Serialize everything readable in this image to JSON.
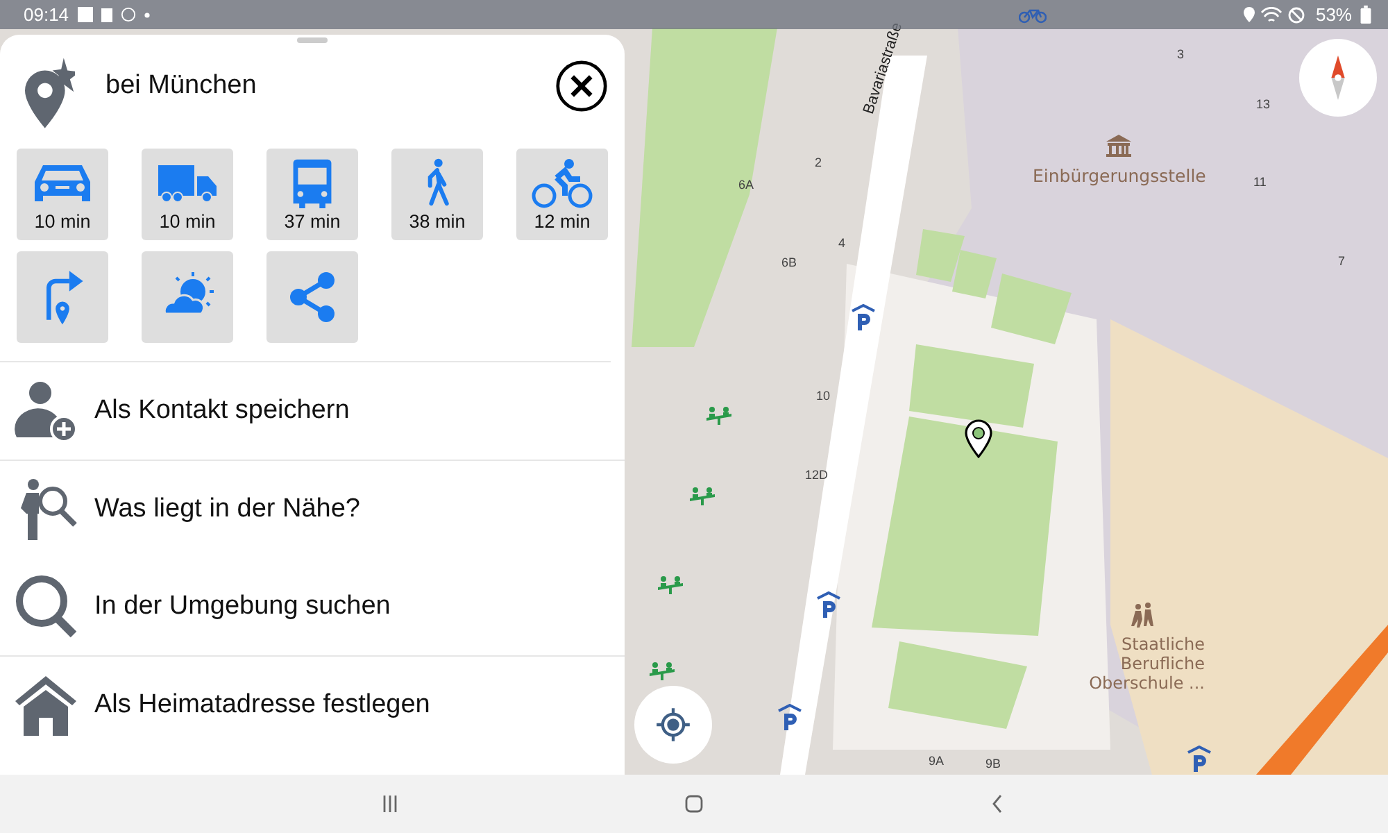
{
  "status_bar": {
    "time": "09:14",
    "battery": "53%"
  },
  "place": {
    "title": "bei München"
  },
  "quick_actions": [
    {
      "kind": "car",
      "label": "10 min"
    },
    {
      "kind": "truck",
      "label": "10 min"
    },
    {
      "kind": "bus",
      "label": "37 min"
    },
    {
      "kind": "walk",
      "label": "38 min"
    },
    {
      "kind": "bike",
      "label": "12 min"
    },
    {
      "kind": "directions"
    },
    {
      "kind": "weather"
    },
    {
      "kind": "share"
    }
  ],
  "menu_sections": [
    [
      {
        "kind": "contact",
        "label": "Als Kontakt speichern"
      }
    ],
    [
      {
        "kind": "nearby",
        "label": "Was liegt in der Nähe?"
      },
      {
        "kind": "search",
        "label": "In der Umgebung suchen"
      }
    ],
    [
      {
        "kind": "home",
        "label": "Als Heimatadresse festlegen"
      }
    ]
  ],
  "map": {
    "street": "Bavariastraße",
    "places": [
      {
        "kind": "office",
        "label": "Einbürgerungsstelle"
      },
      {
        "kind": "school",
        "label": "Staatliche Berufliche Oberschule ..."
      }
    ],
    "house_numbers": [
      "3",
      "13",
      "11",
      "7",
      "2",
      "6A",
      "6B",
      "4",
      "10",
      "12D",
      "9A",
      "9B"
    ]
  }
}
